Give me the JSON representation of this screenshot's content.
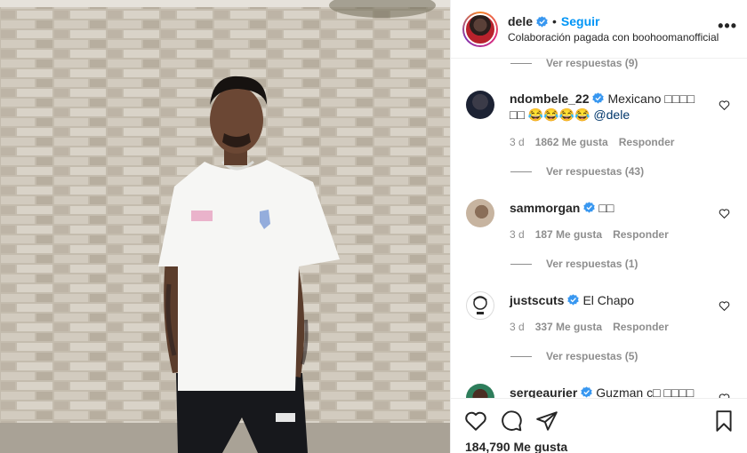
{
  "header": {
    "username": "dele",
    "separator": "•",
    "follow_label": "Seguir",
    "subtitle": "Colaboración pagada con boohoomanofficial",
    "more_label": "•••"
  },
  "comments": {
    "view_replies_top": "Ver respuestas (9)",
    "items": [
      {
        "username": "ndombele_22",
        "text": "Mexicano □□□□ □□ 😂😂😂😂 ",
        "mention": "@dele",
        "age": "3 d",
        "likes": "1862 Me gusta",
        "reply_label": "Responder",
        "view_replies": "Ver respuestas (43)"
      },
      {
        "username": "sammorgan",
        "text": "□□",
        "age": "3 d",
        "likes": "187 Me gusta",
        "reply_label": "Responder",
        "view_replies": "Ver respuestas (1)"
      },
      {
        "username": "justscuts",
        "text": "El Chapo",
        "age": "3 d",
        "likes": "337 Me gusta",
        "reply_label": "Responder",
        "view_replies": "Ver respuestas (5)"
      },
      {
        "username": "sergeaurier",
        "text": "Guzman c□ □□□□"
      }
    ]
  },
  "footer": {
    "likes": "184,790 Me gusta"
  },
  "icons": {
    "like": "heart-icon",
    "comment": "comment-icon",
    "share": "send-icon",
    "save": "bookmark-icon",
    "verified": "verified-badge-icon"
  },
  "colors": {
    "accent": "#0095f6",
    "text": "#262626",
    "muted": "#8e8e8e",
    "verified": "#3897f0"
  }
}
